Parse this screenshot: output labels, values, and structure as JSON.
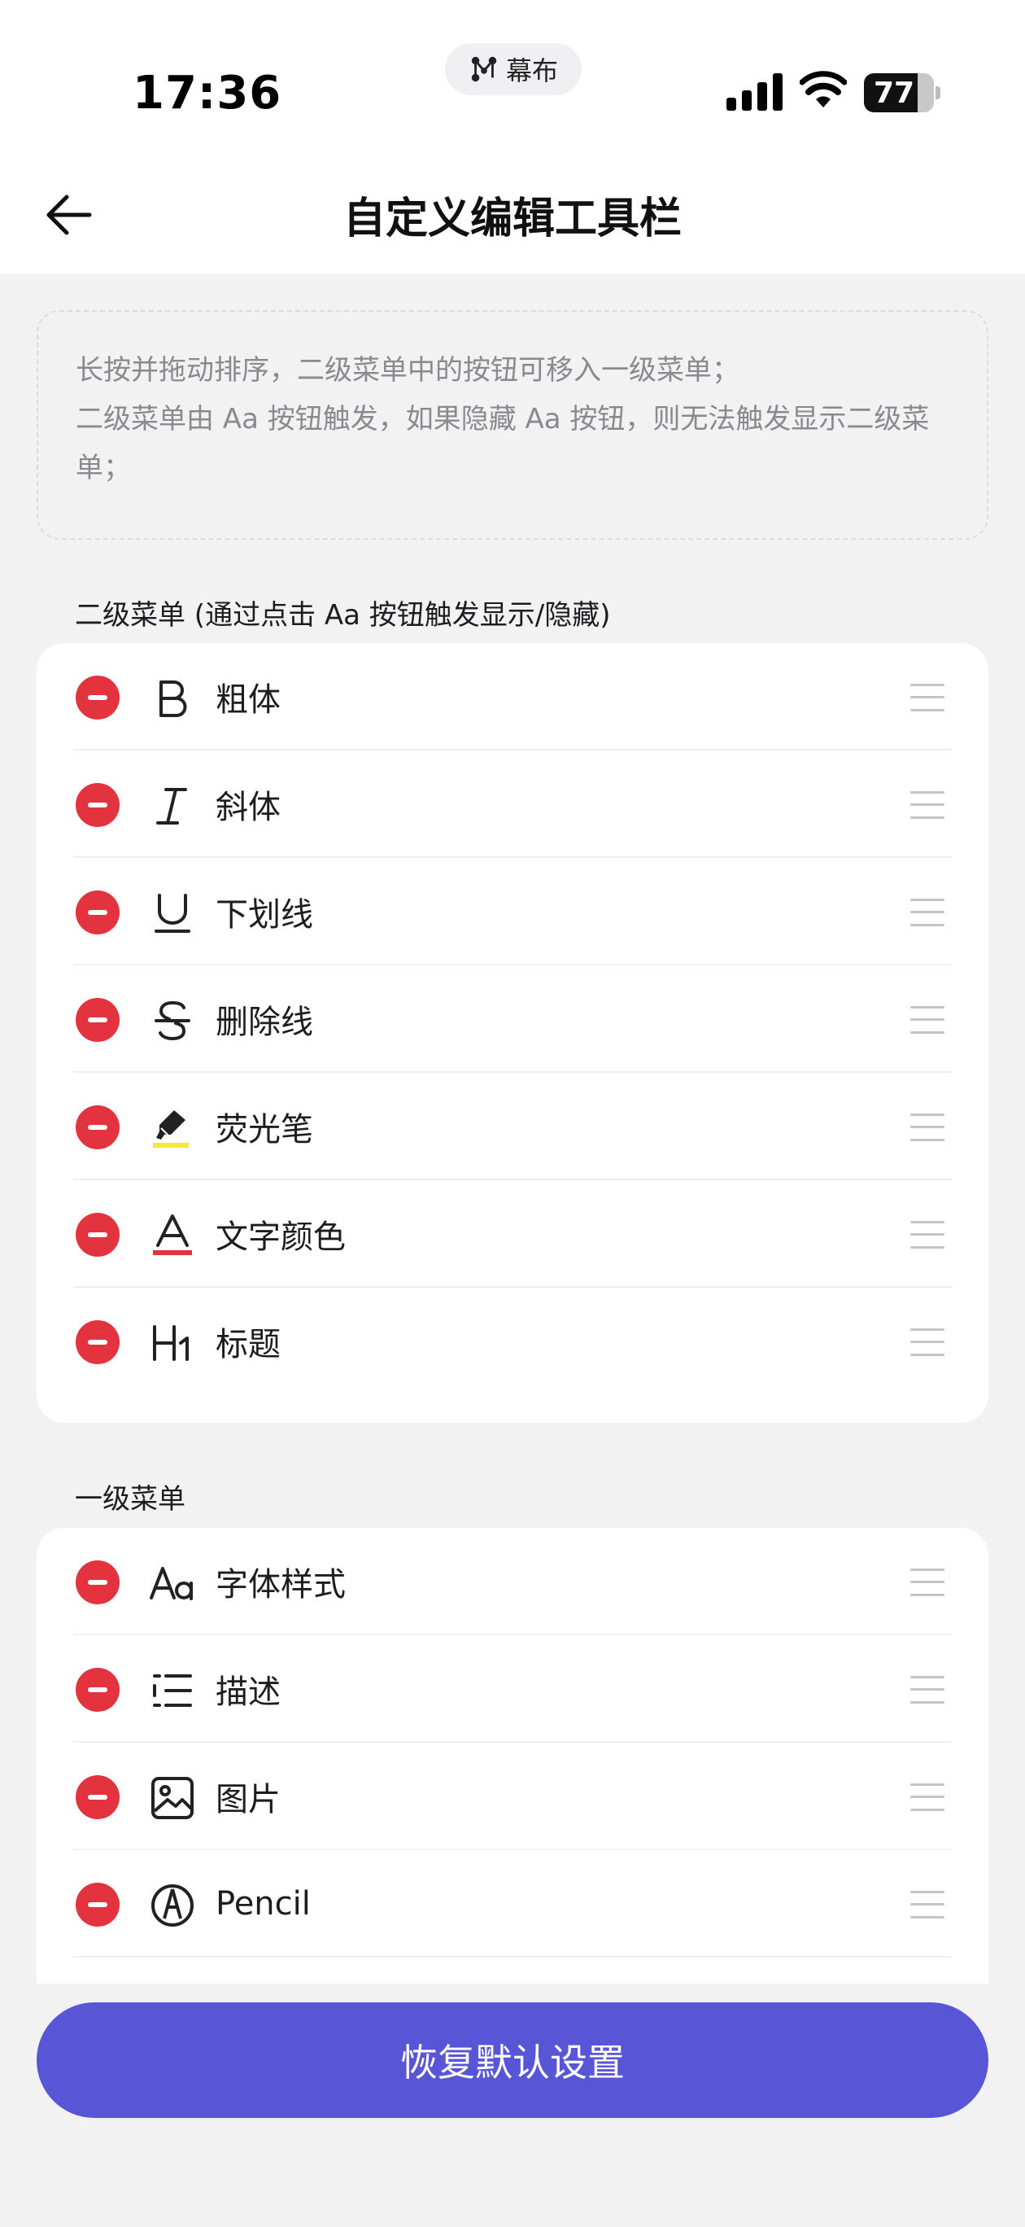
{
  "status_bar": {
    "time": "17:36",
    "island_app": "幕布",
    "battery": 77,
    "battery_text": "77"
  },
  "header": {
    "title": "自定义编辑工具栏"
  },
  "notice": {
    "line1": "长按并拖动排序，二级菜单中的按钮可移入一级菜单；",
    "line2": "二级菜单由 Aa 按钮触发，如果隐藏 Aa 按钮，则无法触发显示二级菜单；"
  },
  "secondary_menu": {
    "label": "二级菜单 (通过点击 Aa 按钮触发显示/隐藏)",
    "items": [
      {
        "label": "粗体",
        "icon": "bold-icon"
      },
      {
        "label": "斜体",
        "icon": "italic-icon"
      },
      {
        "label": "下划线",
        "icon": "underline-icon"
      },
      {
        "label": "删除线",
        "icon": "strikethrough-icon"
      },
      {
        "label": "荧光笔",
        "icon": "highlighter-icon"
      },
      {
        "label": "文字颜色",
        "icon": "text-color-icon"
      },
      {
        "label": "标题",
        "icon": "heading-icon"
      }
    ]
  },
  "primary_menu": {
    "label": "一级菜单",
    "items": [
      {
        "label": "字体样式",
        "icon": "font-style-icon"
      },
      {
        "label": "描述",
        "icon": "description-icon"
      },
      {
        "label": "图片",
        "icon": "image-icon"
      },
      {
        "label": "Pencil",
        "icon": "pencil-icon"
      }
    ]
  },
  "restore_button": "恢复默认设置",
  "colors": {
    "accent": "#5856d6",
    "remove": "#e3333e",
    "highlighter": "#f5ea3b",
    "text_color_underline": "#e3333e"
  }
}
